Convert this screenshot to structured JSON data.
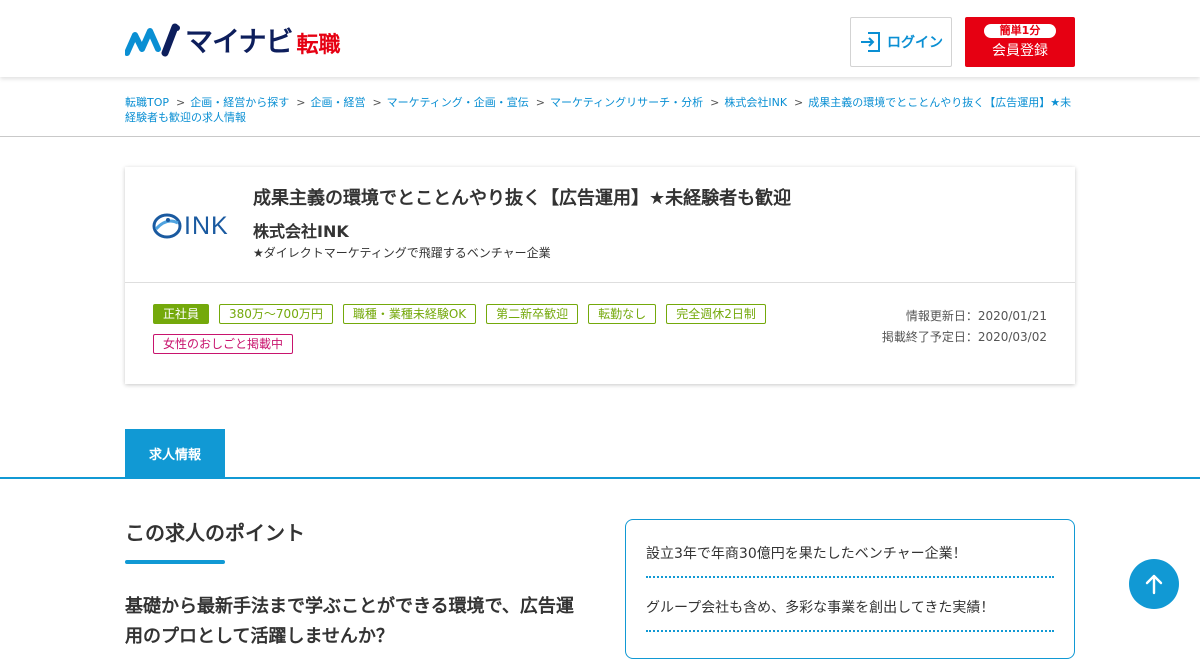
{
  "header": {
    "logo_text": "マイナビ",
    "logo_sub": "転職",
    "login_label": "ログイン",
    "register_badge": "簡単1分",
    "register_label": "会員登録"
  },
  "breadcrumb": [
    "転職TOP",
    "企画・経営から探す",
    "企画・経営",
    "マーケティング・企画・宣伝",
    "マーケティングリサーチ・分析",
    "株式会社INK",
    "成果主義の環境でとことんやり抜く【広告運用】★未経験者も歓迎の求人情報"
  ],
  "job": {
    "company_logo_text": "INK",
    "title": "成果主義の環境でとことんやり抜く【広告運用】★未経験者も歓迎",
    "company": "株式会社INK",
    "catch": "★ダイレクトマーケティングで飛躍するベンチャー企業",
    "tags_row1": [
      "正社員",
      "380万～700万円",
      "職種・業種未経験OK",
      "第二新卒歓迎",
      "転勤なし",
      "完全週休2日制"
    ],
    "tags_row2": [
      "女性のおしごと掲載中"
    ],
    "updated": "情報更新日：2020/01/21",
    "end_date": "掲載終了予定日：2020/03/02"
  },
  "tabs": {
    "active": "求人情報"
  },
  "points": {
    "heading": "この求人のポイント",
    "lead": "基礎から最新手法まで学ぶことができる環境で、広告運用のプロとして活躍しませんか？"
  },
  "features": [
    "設立3年で年商30億円を果たしたベンチャー企業！",
    "グループ会社も含め、多彩な事業を創出してきた実績！"
  ],
  "colors": {
    "brand_navy": "#0d1e5c",
    "brand_red": "#e60012",
    "accent_blue": "#1199d4",
    "tag_green": "#74a90b",
    "tag_pink": "#c8146e"
  }
}
